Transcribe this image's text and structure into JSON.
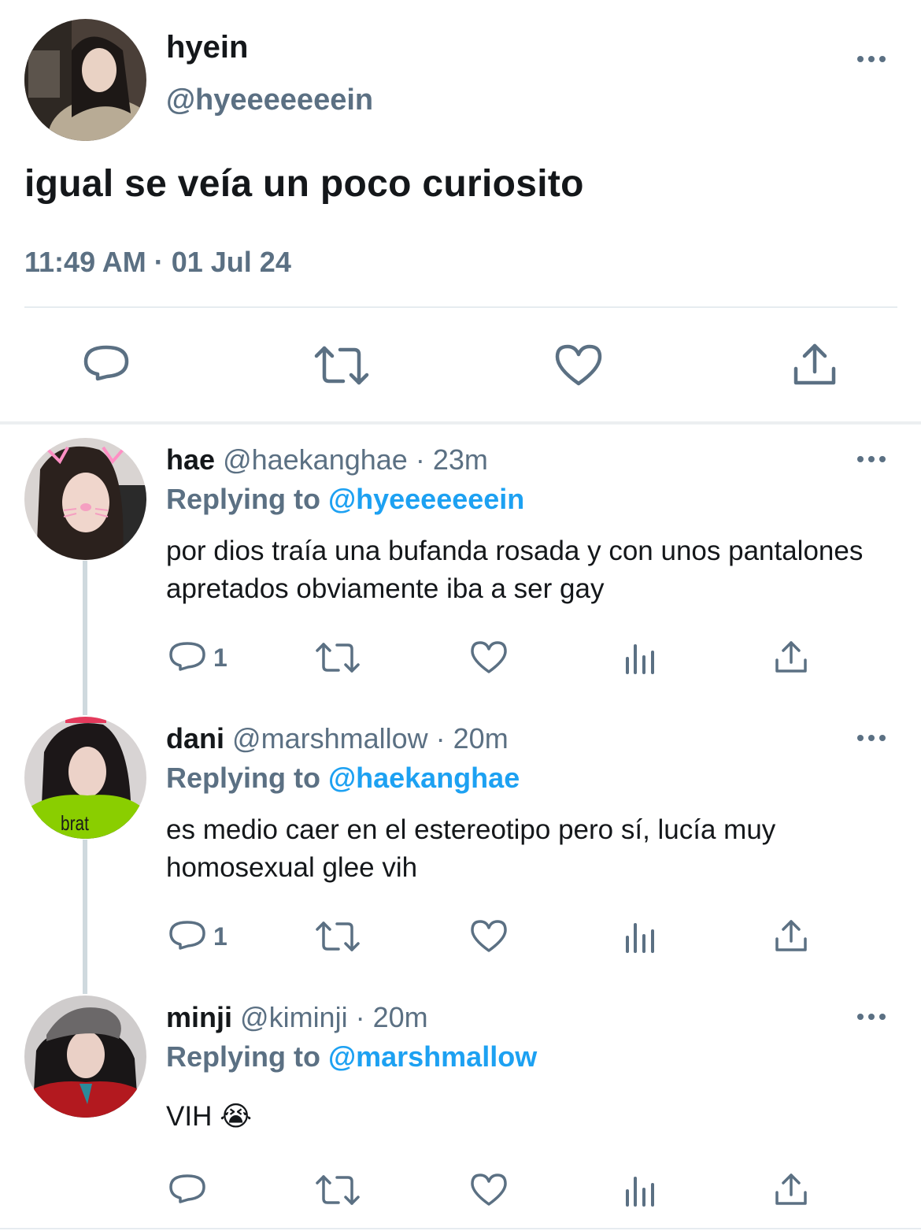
{
  "tweet": {
    "name": "hyein",
    "handle": "@hyeeeeeeein",
    "text": "igual se veía un poco curiosito",
    "timestamp": "11:49 AM · 01 Jul 24"
  },
  "replies": [
    {
      "name": "hae",
      "handle": "@haekanghae",
      "time": "23m",
      "replying_label": "Replying to",
      "replying_to": "@hyeeeeeeein",
      "text": "por dios traía una bufanda rosada y con unos pantalones apretados obviamente iba a ser gay",
      "reply_count": "1"
    },
    {
      "name": "dani",
      "handle": "@marshmallow",
      "time": "20m",
      "replying_label": "Replying to",
      "replying_to": "@haekanghae",
      "text": "es medio caer en el estereotipo pero sí, lucía muy homosexual glee vih",
      "reply_count": "1",
      "avatar_text": "brat"
    },
    {
      "name": "minji",
      "handle": "@kiminji",
      "time": "20m",
      "replying_label": "Replying to",
      "replying_to": "@marshmallow",
      "text": "VIH 😭",
      "reply_count": ""
    }
  ],
  "colors": {
    "text": "#14171a",
    "secondary": "#5b7083",
    "link": "#1da1f2",
    "divider": "#e6ecf0",
    "brat_green": "#8ace00"
  }
}
